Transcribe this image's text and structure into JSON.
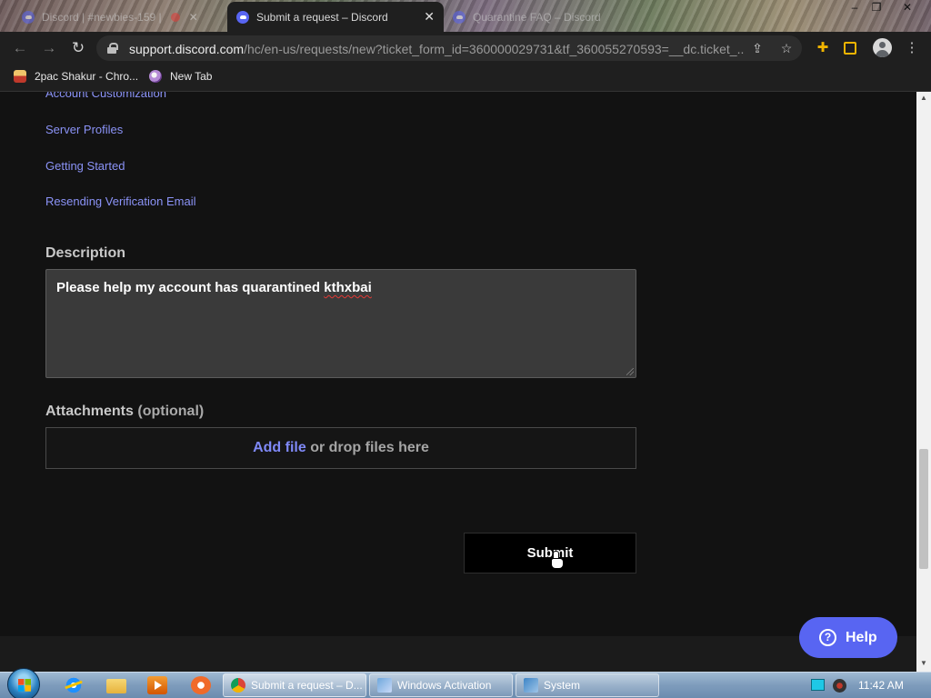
{
  "browser": {
    "tabs": [
      {
        "title": "Discord | #newbies-159 |",
        "state": "background"
      },
      {
        "title": "Submit a request – Discord",
        "state": "active"
      },
      {
        "title": "Quarantine FAQ – Discord",
        "state": "background"
      }
    ],
    "tab_close_glyph": "✕",
    "window_controls": [
      "–",
      "❐",
      "✕"
    ],
    "nav": {
      "back": "←",
      "forward": "→",
      "reload": "↻"
    },
    "url": {
      "host": "support.discord.com",
      "path": "/hc/en-us/requests/new?ticket_form_id=360000029731&tf_360055270593=__dc.ticket_..."
    },
    "bookmarks": [
      {
        "label": "2pac Shakur - Chro..."
      },
      {
        "label": "New Tab"
      }
    ]
  },
  "page": {
    "links": [
      "Account Customization",
      "Server Profiles",
      "Getting Started",
      "Resending Verification Email"
    ],
    "description": {
      "label": "Description",
      "text_before": "Please help my account has quarantined ",
      "text_misspelled": "kthxbai"
    },
    "attachments": {
      "label": "Attachments",
      "optional": "(optional)",
      "add_file": "Add file",
      "drop_text": " or drop files here"
    },
    "submit_label": "Submit",
    "help_label": "Help",
    "help_glyph": "?"
  },
  "taskbar": {
    "buttons": [
      {
        "label": "Submit a request – D..."
      },
      {
        "label": "Windows Activation"
      },
      {
        "label": "System"
      }
    ],
    "clock": "11:42 AM"
  },
  "colors": {
    "accent": "#5865f2",
    "link": "#8b93f7",
    "page_bg": "#121212"
  }
}
